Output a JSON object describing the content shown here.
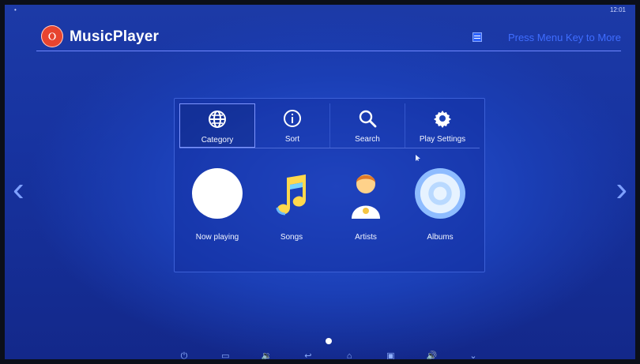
{
  "status": {
    "left": "•",
    "right": "12:01"
  },
  "app": {
    "title": "MusicPlayer",
    "menu_hint": "Press Menu Key to More"
  },
  "nav": {
    "left_arrow": "‹",
    "right_arrow": "›"
  },
  "tabs": [
    {
      "label": "Category",
      "icon": "globe-icon",
      "active": true
    },
    {
      "label": "Sort",
      "icon": "info-icon",
      "active": false
    },
    {
      "label": "Search",
      "icon": "search-icon",
      "active": false
    },
    {
      "label": "Play Settings",
      "icon": "gear-icon",
      "active": false
    }
  ],
  "tiles": [
    {
      "label": "Now playing",
      "icon": "now-playing-icon"
    },
    {
      "label": "Songs",
      "icon": "music-note-icon"
    },
    {
      "label": "Artists",
      "icon": "artist-icon"
    },
    {
      "label": "Albums",
      "icon": "album-disc-icon"
    }
  ],
  "bottom_nav": {
    "icons": [
      "power-icon",
      "screenshot-icon",
      "volume-down-icon",
      "back-icon",
      "home-icon",
      "recent-apps-icon",
      "volume-up-icon",
      "collapse-icon"
    ]
  },
  "colors": {
    "background": "#1b3fb6",
    "accent": "#3f6dff",
    "app_icon": "#e7442f"
  }
}
